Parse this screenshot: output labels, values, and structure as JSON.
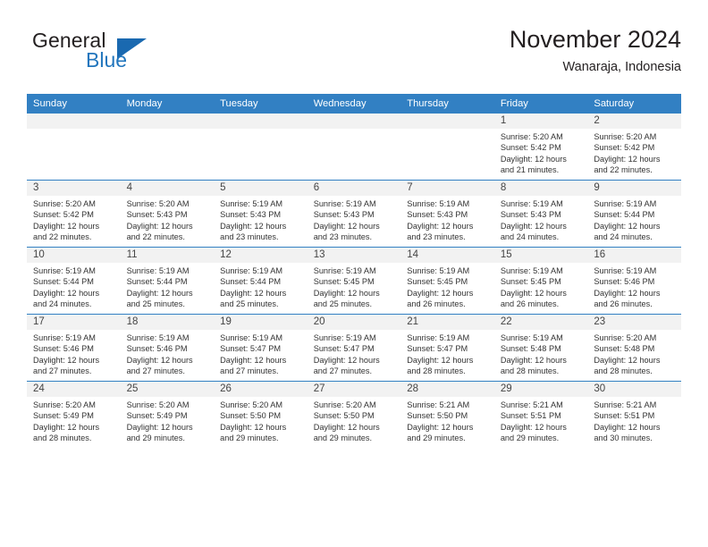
{
  "brand": {
    "name_part1": "General",
    "name_part2": "Blue",
    "accent_color": "#2276bd",
    "triangle_color": "#1a69b0"
  },
  "header": {
    "title": "November 2024",
    "subtitle": "Wanaraja, Indonesia"
  },
  "theme": {
    "header_row_bg": "#3280c3",
    "day_band_bg": "#f2f2f2",
    "cell_border_top": "#3280c3",
    "text_color": "#333333"
  },
  "weekdays": [
    "Sunday",
    "Monday",
    "Tuesday",
    "Wednesday",
    "Thursday",
    "Friday",
    "Saturday"
  ],
  "weeks": [
    [
      {
        "day": "",
        "sunrise": "",
        "sunset": "",
        "daylight1": "",
        "daylight2": ""
      },
      {
        "day": "",
        "sunrise": "",
        "sunset": "",
        "daylight1": "",
        "daylight2": ""
      },
      {
        "day": "",
        "sunrise": "",
        "sunset": "",
        "daylight1": "",
        "daylight2": ""
      },
      {
        "day": "",
        "sunrise": "",
        "sunset": "",
        "daylight1": "",
        "daylight2": ""
      },
      {
        "day": "",
        "sunrise": "",
        "sunset": "",
        "daylight1": "",
        "daylight2": ""
      },
      {
        "day": "1",
        "sunrise": "Sunrise: 5:20 AM",
        "sunset": "Sunset: 5:42 PM",
        "daylight1": "Daylight: 12 hours",
        "daylight2": "and 21 minutes."
      },
      {
        "day": "2",
        "sunrise": "Sunrise: 5:20 AM",
        "sunset": "Sunset: 5:42 PM",
        "daylight1": "Daylight: 12 hours",
        "daylight2": "and 22 minutes."
      }
    ],
    [
      {
        "day": "3",
        "sunrise": "Sunrise: 5:20 AM",
        "sunset": "Sunset: 5:42 PM",
        "daylight1": "Daylight: 12 hours",
        "daylight2": "and 22 minutes."
      },
      {
        "day": "4",
        "sunrise": "Sunrise: 5:20 AM",
        "sunset": "Sunset: 5:43 PM",
        "daylight1": "Daylight: 12 hours",
        "daylight2": "and 22 minutes."
      },
      {
        "day": "5",
        "sunrise": "Sunrise: 5:19 AM",
        "sunset": "Sunset: 5:43 PM",
        "daylight1": "Daylight: 12 hours",
        "daylight2": "and 23 minutes."
      },
      {
        "day": "6",
        "sunrise": "Sunrise: 5:19 AM",
        "sunset": "Sunset: 5:43 PM",
        "daylight1": "Daylight: 12 hours",
        "daylight2": "and 23 minutes."
      },
      {
        "day": "7",
        "sunrise": "Sunrise: 5:19 AM",
        "sunset": "Sunset: 5:43 PM",
        "daylight1": "Daylight: 12 hours",
        "daylight2": "and 23 minutes."
      },
      {
        "day": "8",
        "sunrise": "Sunrise: 5:19 AM",
        "sunset": "Sunset: 5:43 PM",
        "daylight1": "Daylight: 12 hours",
        "daylight2": "and 24 minutes."
      },
      {
        "day": "9",
        "sunrise": "Sunrise: 5:19 AM",
        "sunset": "Sunset: 5:44 PM",
        "daylight1": "Daylight: 12 hours",
        "daylight2": "and 24 minutes."
      }
    ],
    [
      {
        "day": "10",
        "sunrise": "Sunrise: 5:19 AM",
        "sunset": "Sunset: 5:44 PM",
        "daylight1": "Daylight: 12 hours",
        "daylight2": "and 24 minutes."
      },
      {
        "day": "11",
        "sunrise": "Sunrise: 5:19 AM",
        "sunset": "Sunset: 5:44 PM",
        "daylight1": "Daylight: 12 hours",
        "daylight2": "and 25 minutes."
      },
      {
        "day": "12",
        "sunrise": "Sunrise: 5:19 AM",
        "sunset": "Sunset: 5:44 PM",
        "daylight1": "Daylight: 12 hours",
        "daylight2": "and 25 minutes."
      },
      {
        "day": "13",
        "sunrise": "Sunrise: 5:19 AM",
        "sunset": "Sunset: 5:45 PM",
        "daylight1": "Daylight: 12 hours",
        "daylight2": "and 25 minutes."
      },
      {
        "day": "14",
        "sunrise": "Sunrise: 5:19 AM",
        "sunset": "Sunset: 5:45 PM",
        "daylight1": "Daylight: 12 hours",
        "daylight2": "and 26 minutes."
      },
      {
        "day": "15",
        "sunrise": "Sunrise: 5:19 AM",
        "sunset": "Sunset: 5:45 PM",
        "daylight1": "Daylight: 12 hours",
        "daylight2": "and 26 minutes."
      },
      {
        "day": "16",
        "sunrise": "Sunrise: 5:19 AM",
        "sunset": "Sunset: 5:46 PM",
        "daylight1": "Daylight: 12 hours",
        "daylight2": "and 26 minutes."
      }
    ],
    [
      {
        "day": "17",
        "sunrise": "Sunrise: 5:19 AM",
        "sunset": "Sunset: 5:46 PM",
        "daylight1": "Daylight: 12 hours",
        "daylight2": "and 27 minutes."
      },
      {
        "day": "18",
        "sunrise": "Sunrise: 5:19 AM",
        "sunset": "Sunset: 5:46 PM",
        "daylight1": "Daylight: 12 hours",
        "daylight2": "and 27 minutes."
      },
      {
        "day": "19",
        "sunrise": "Sunrise: 5:19 AM",
        "sunset": "Sunset: 5:47 PM",
        "daylight1": "Daylight: 12 hours",
        "daylight2": "and 27 minutes."
      },
      {
        "day": "20",
        "sunrise": "Sunrise: 5:19 AM",
        "sunset": "Sunset: 5:47 PM",
        "daylight1": "Daylight: 12 hours",
        "daylight2": "and 27 minutes."
      },
      {
        "day": "21",
        "sunrise": "Sunrise: 5:19 AM",
        "sunset": "Sunset: 5:47 PM",
        "daylight1": "Daylight: 12 hours",
        "daylight2": "and 28 minutes."
      },
      {
        "day": "22",
        "sunrise": "Sunrise: 5:19 AM",
        "sunset": "Sunset: 5:48 PM",
        "daylight1": "Daylight: 12 hours",
        "daylight2": "and 28 minutes."
      },
      {
        "day": "23",
        "sunrise": "Sunrise: 5:20 AM",
        "sunset": "Sunset: 5:48 PM",
        "daylight1": "Daylight: 12 hours",
        "daylight2": "and 28 minutes."
      }
    ],
    [
      {
        "day": "24",
        "sunrise": "Sunrise: 5:20 AM",
        "sunset": "Sunset: 5:49 PM",
        "daylight1": "Daylight: 12 hours",
        "daylight2": "and 28 minutes."
      },
      {
        "day": "25",
        "sunrise": "Sunrise: 5:20 AM",
        "sunset": "Sunset: 5:49 PM",
        "daylight1": "Daylight: 12 hours",
        "daylight2": "and 29 minutes."
      },
      {
        "day": "26",
        "sunrise": "Sunrise: 5:20 AM",
        "sunset": "Sunset: 5:50 PM",
        "daylight1": "Daylight: 12 hours",
        "daylight2": "and 29 minutes."
      },
      {
        "day": "27",
        "sunrise": "Sunrise: 5:20 AM",
        "sunset": "Sunset: 5:50 PM",
        "daylight1": "Daylight: 12 hours",
        "daylight2": "and 29 minutes."
      },
      {
        "day": "28",
        "sunrise": "Sunrise: 5:21 AM",
        "sunset": "Sunset: 5:50 PM",
        "daylight1": "Daylight: 12 hours",
        "daylight2": "and 29 minutes."
      },
      {
        "day": "29",
        "sunrise": "Sunrise: 5:21 AM",
        "sunset": "Sunset: 5:51 PM",
        "daylight1": "Daylight: 12 hours",
        "daylight2": "and 29 minutes."
      },
      {
        "day": "30",
        "sunrise": "Sunrise: 5:21 AM",
        "sunset": "Sunset: 5:51 PM",
        "daylight1": "Daylight: 12 hours",
        "daylight2": "and 30 minutes."
      }
    ]
  ]
}
